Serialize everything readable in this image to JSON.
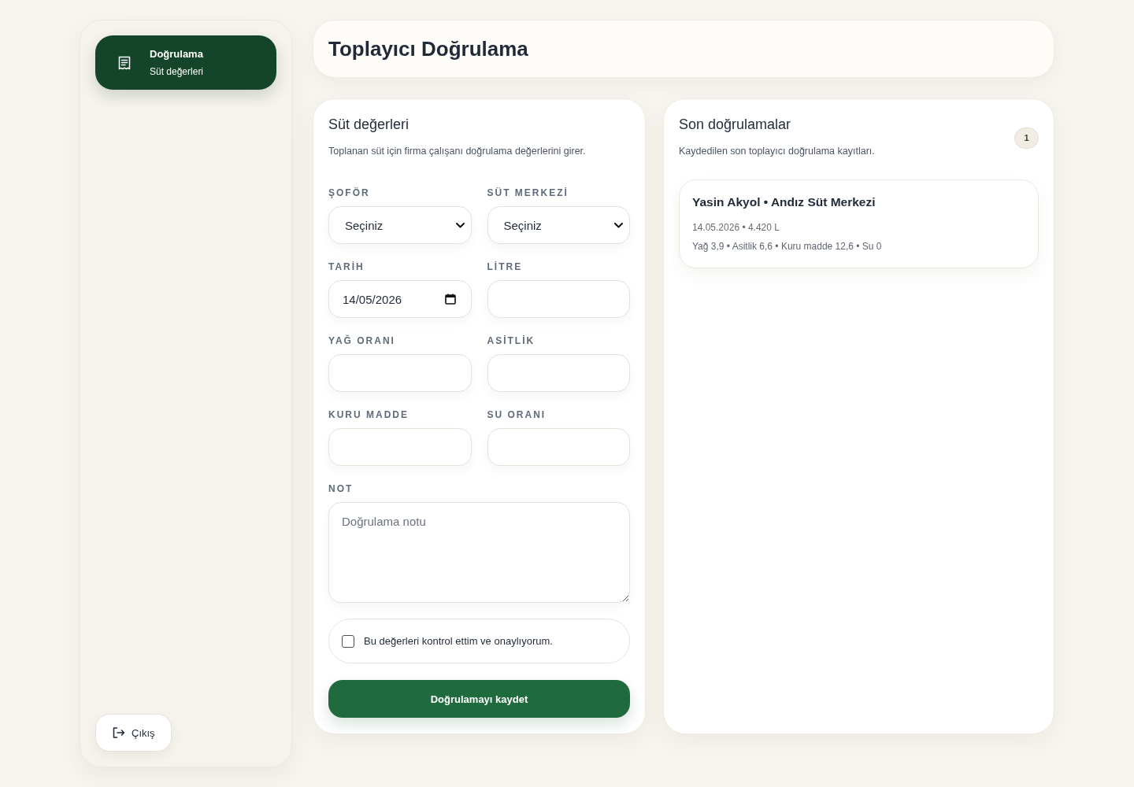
{
  "sidebar": {
    "nav_items": [
      {
        "title": "Doğrulama",
        "subtitle": "Süt değerleri",
        "selected": true
      }
    ],
    "logout_button": "Çıkış"
  },
  "header": {
    "title": "Toplayıcı Doğrulama"
  },
  "form": {
    "title": "Süt değerleri",
    "description": "Toplanan süt için firma çalışanı doğrulama değerlerini girer.",
    "fields": [
      {
        "kind": "select",
        "label": "ŞOFÖR",
        "value": "Seçiniz"
      },
      {
        "kind": "select",
        "label": "SÜT MERKEZİ",
        "value": "Seçiniz"
      },
      {
        "kind": "date",
        "label": "TARİH",
        "value": "14/05/2026"
      },
      {
        "kind": "input",
        "label": "LİTRE"
      },
      {
        "kind": "input",
        "label": "YAĞ ORANI"
      },
      {
        "kind": "input",
        "label": "ASİTLİK"
      },
      {
        "kind": "input",
        "label": "KURU MADDE"
      },
      {
        "kind": "input",
        "label": "SU ORANI"
      },
      {
        "kind": "textarea",
        "label": "NOT",
        "placeholder": "Doğrulama notu"
      }
    ],
    "confirm": {
      "label": "Bu değerleri kontrol ettim ve onaylıyorum.",
      "checked": false
    },
    "submit_button": "Doğrulamayı kaydet"
  },
  "recent": {
    "title": "Son doğrulamalar",
    "description": "Kaydedilen son toplayıcı doğrulama kayıtları.",
    "count": "1",
    "entries": [
      {
        "title": "Yasin Akyol • Andız Süt Merkezi",
        "meta": "14.05.2026 • 4.420 L",
        "values": "Yağ 3,9 • Asitlik 6,6 • Kuru madde 12,6 • Su 0"
      }
    ]
  }
}
